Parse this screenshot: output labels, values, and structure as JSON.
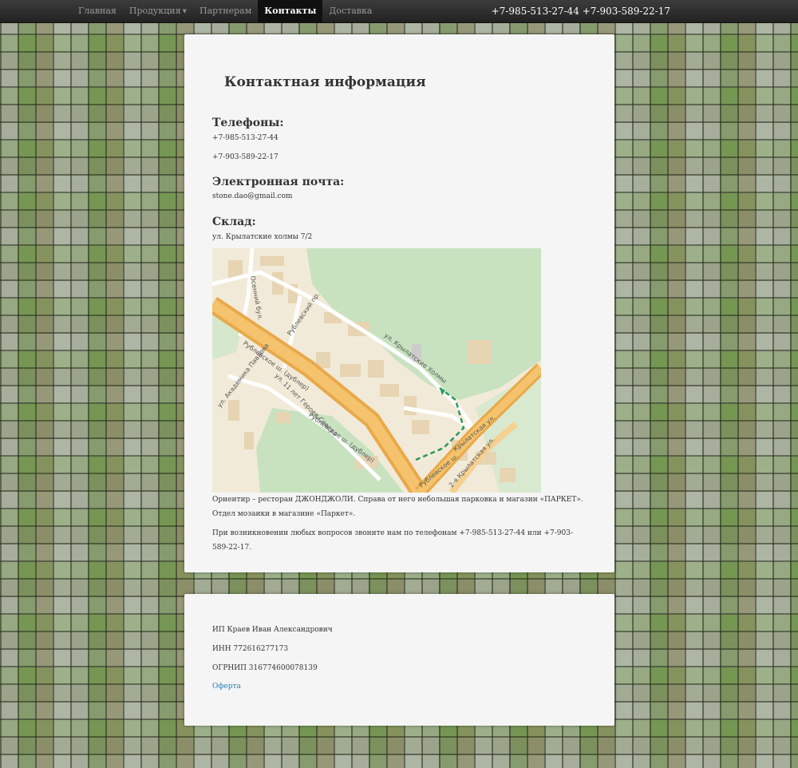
{
  "nav": {
    "items": [
      {
        "label": "Главная",
        "active": false
      },
      {
        "label": "Продукция",
        "active": false,
        "has_dropdown": true
      },
      {
        "label": "Партнерам",
        "active": false
      },
      {
        "label": "Контакты",
        "active": true
      },
      {
        "label": "Доставка",
        "active": false
      }
    ],
    "phones": "+7-985-513-27-44 +7-903-589-22-17"
  },
  "main": {
    "title": "Контактная информация",
    "phones_heading": "Телефоны:",
    "phone1": "+7-985-513-27-44",
    "phone2": "+7-903-589-22-17",
    "email_heading": "Электронная почта:",
    "email": "stone.dao@gmail.com",
    "warehouse_heading": "Склад:",
    "address": "ул. Крылатские холмы 7/2",
    "map_labels": {
      "road1": "Рублевское ш. (дублер)",
      "road2": "Рублевское ш. (дублер)",
      "road3": "Крылатская ул.",
      "road4": "Рублевское ш.",
      "road5": "ул. Крылатские Холмы",
      "road6": "ул. Академика Павлова",
      "road7": "ул. 11 лет Героев Севера",
      "road8": "Осенний бул.",
      "road9": "Рублевский пр.",
      "road10": "2-я Крылатская ул."
    },
    "note": "Ориентир – ресторан ДЖОНДЖОЛИ. Справа от него небольшая парковка и магазин «ПАРКЕТ». Отдел мозаики в магазине «Паркет».",
    "contact_note": "При возникновении любых вопросов звоните нам по телефонам +7-985-513-27-44 или +7-903-589-22-17."
  },
  "footer": {
    "owner": "ИП Краев Иван Александрович",
    "inn": "ИНН 772616277173",
    "ogrnip": "ОГРНИП 316774600078139",
    "offer_link": "Оферта"
  },
  "colors": {
    "nav_bg": "#2a2a2a",
    "card_bg": "#f5f5f5",
    "link": "#2a7cb8",
    "map_green": "#c8e2c0",
    "map_beige": "#f2ead8",
    "map_road": "#f0b050"
  }
}
